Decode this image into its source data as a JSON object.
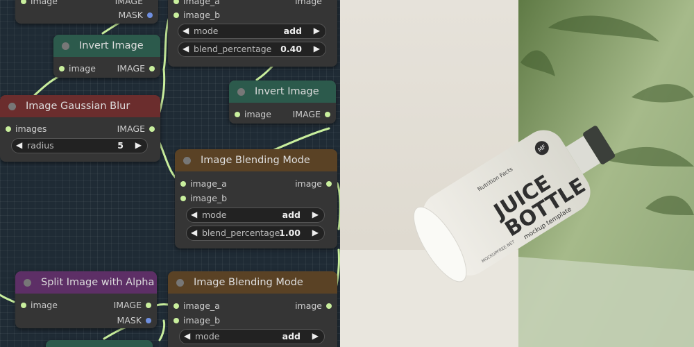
{
  "colors": {
    "canvas_bg": "#1f2b35",
    "node_body": "#353535",
    "wire": "#c9ef9d",
    "title_invert": "#2c5a4c",
    "title_blur": "#6b2d2d",
    "title_blend": "#5a4225",
    "title_split": "#5d2f66"
  },
  "nodes": {
    "top_partial": {
      "rows": [
        {
          "in": "image",
          "out": "IMAGE"
        },
        {
          "in": "",
          "out": "MASK"
        }
      ]
    },
    "blend_top": {
      "rows": [
        {
          "in": "image_a",
          "out": "image"
        },
        {
          "in": "image_b",
          "out": ""
        }
      ],
      "widgets": [
        {
          "label": "mode",
          "value": "add"
        },
        {
          "label": "blend_percentage",
          "value": "0.40"
        }
      ]
    },
    "invert_1": {
      "title": "Invert Image",
      "rows": [
        {
          "in": "image",
          "out": "IMAGE"
        }
      ]
    },
    "invert_2": {
      "title": "Invert Image",
      "rows": [
        {
          "in": "image",
          "out": "IMAGE"
        }
      ]
    },
    "blur": {
      "title": "Image Gaussian Blur",
      "rows": [
        {
          "in": "images",
          "out": "IMAGE"
        }
      ],
      "widgets": [
        {
          "label": "radius",
          "value": "5"
        }
      ]
    },
    "blend_mid": {
      "title": "Image Blending Mode",
      "rows": [
        {
          "in": "image_a",
          "out": "image"
        },
        {
          "in": "image_b",
          "out": ""
        }
      ],
      "widgets": [
        {
          "label": "mode",
          "value": "add"
        },
        {
          "label": "blend_percentage",
          "value": "1.00"
        }
      ]
    },
    "split": {
      "title": "Split Image with Alpha",
      "rows": [
        {
          "in": "image",
          "out": "IMAGE"
        },
        {
          "in": "",
          "out": "MASK"
        }
      ]
    },
    "blend_bottom": {
      "title": "Image Blending Mode",
      "rows": [
        {
          "in": "image_a",
          "out": "image"
        },
        {
          "in": "image_b",
          "out": ""
        }
      ],
      "widgets": [
        {
          "label": "mode",
          "value": "add"
        }
      ]
    }
  },
  "photo": {
    "label_small_top": "Nutrition Facts",
    "logo": "MF",
    "brand_line1": "JUICE",
    "brand_line2": "BOTTLE",
    "tagline": "mockup template",
    "side_text": "MOCKUPFREE.NET"
  }
}
